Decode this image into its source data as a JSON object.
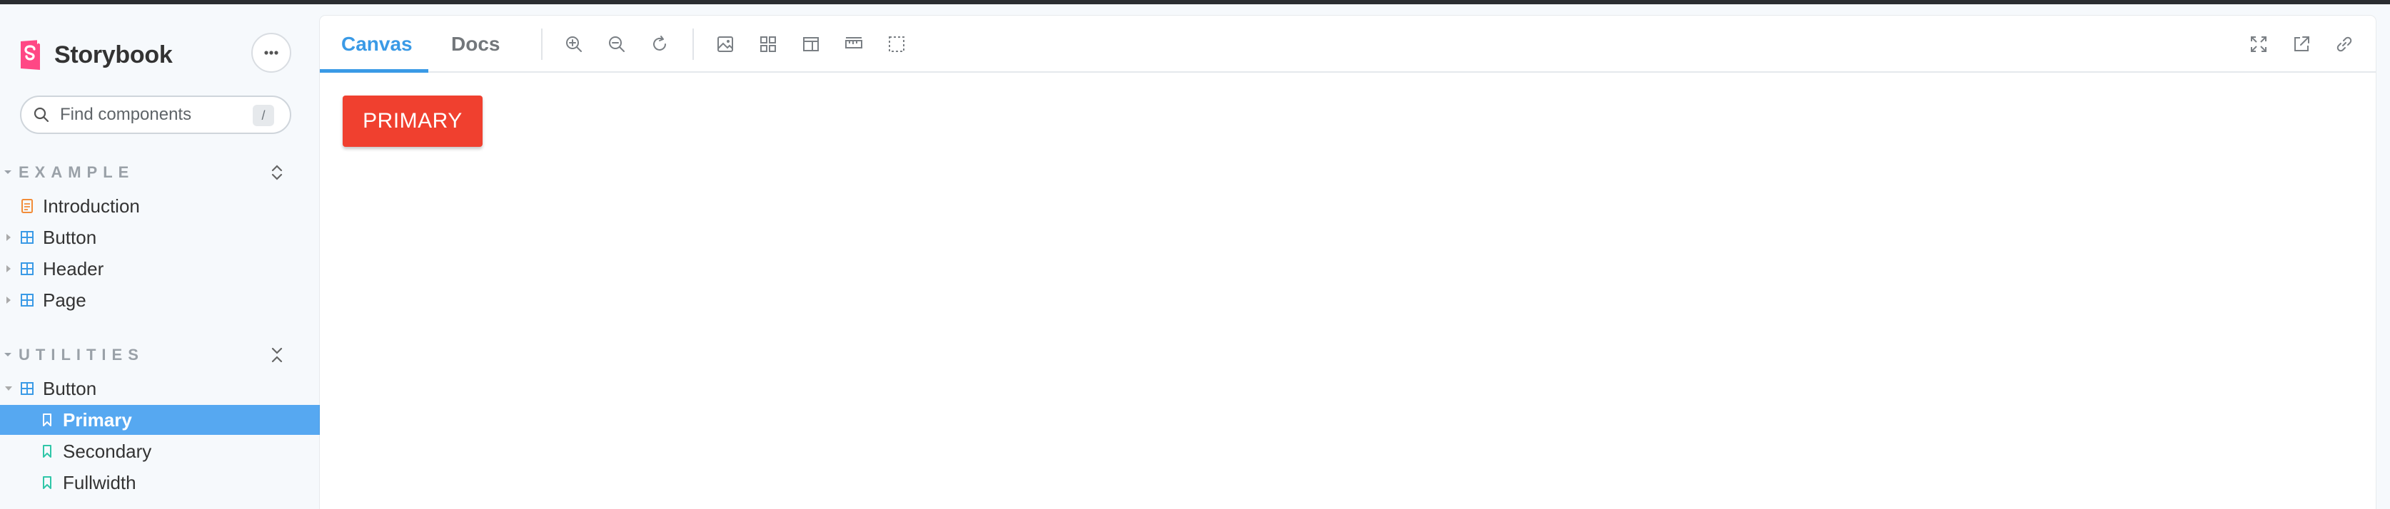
{
  "app": {
    "name": "Storybook",
    "brand_color": "#ff4785"
  },
  "search": {
    "placeholder": "Find components",
    "shortcut": "/"
  },
  "sidebar": {
    "sections": [
      {
        "title": "EXAMPLE",
        "items": [
          {
            "label": "Introduction",
            "icon": "document-icon",
            "expandable": false
          },
          {
            "label": "Button",
            "icon": "component-icon",
            "expandable": true
          },
          {
            "label": "Header",
            "icon": "component-icon",
            "expandable": true
          },
          {
            "label": "Page",
            "icon": "component-icon",
            "expandable": true
          }
        ]
      },
      {
        "title": "UTILITIES",
        "items": [
          {
            "label": "Button",
            "icon": "component-icon",
            "expandable": true,
            "expanded": true
          },
          {
            "label": "Primary",
            "icon": "bookmark-icon",
            "selected": true
          },
          {
            "label": "Secondary",
            "icon": "bookmark-icon"
          },
          {
            "label": "Fullwidth",
            "icon": "bookmark-icon"
          }
        ]
      }
    ]
  },
  "toolbar": {
    "tabs": [
      {
        "label": "Canvas",
        "active": true
      },
      {
        "label": "Docs",
        "active": false
      }
    ],
    "tools": [
      "zoom-in-icon",
      "zoom-out-icon",
      "reset-zoom-icon",
      "background-icon",
      "grid-icon",
      "viewport-icon",
      "measure-icon",
      "outline-icon"
    ],
    "right_tools": [
      "fullscreen-icon",
      "open-new-tab-icon",
      "copy-link-icon"
    ]
  },
  "canvas": {
    "primary_button_label": "PRIMARY",
    "primary_button_color": "#f0402f"
  },
  "colors": {
    "accent": "#3a9ae6",
    "selected_row": "#56a8f1"
  }
}
